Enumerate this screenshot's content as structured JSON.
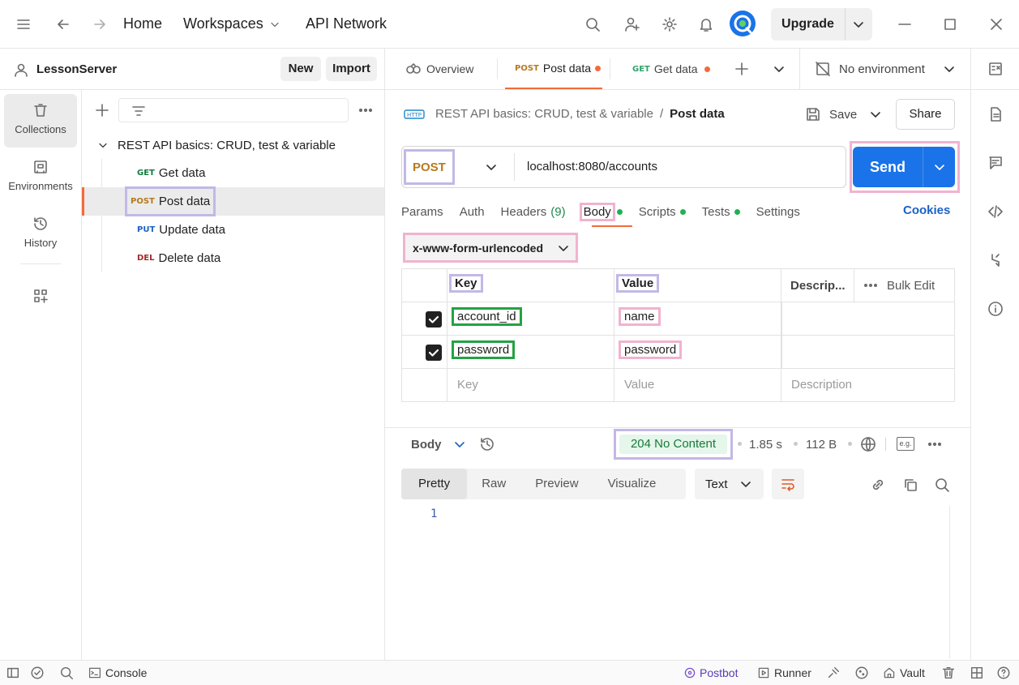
{
  "topbar": {
    "home": "Home",
    "workspaces": "Workspaces",
    "api_network": "API Network",
    "upgrade": "Upgrade",
    "avatar_color": "#1a73e8"
  },
  "sidebar": {
    "workspace_name": "LessonServer",
    "new_label": "New",
    "import_label": "Import",
    "rail": [
      {
        "label": "Collections",
        "icon": "trash-can-icon"
      },
      {
        "label": "Environments",
        "icon": "environment-icon"
      },
      {
        "label": "History",
        "icon": "history-icon"
      }
    ],
    "collection_name": "REST API basics: CRUD, test & variable",
    "requests": [
      {
        "method": "GET",
        "name": "Get data"
      },
      {
        "method": "POST",
        "name": "Post data"
      },
      {
        "method": "PUT",
        "name": "Update data"
      },
      {
        "method": "DEL",
        "name": "Delete data"
      }
    ]
  },
  "tabs": {
    "overview": "Overview",
    "tab1_method": "POST",
    "tab1_name": "Post data",
    "tab2_method": "GET",
    "tab2_name": "Get data",
    "environment": "No environment"
  },
  "request": {
    "breadcrumb_collection": "REST API basics: CRUD, test & variable",
    "breadcrumb_sep": "/",
    "breadcrumb_request": "Post data",
    "save": "Save",
    "share": "Share",
    "method": "POST",
    "url": "localhost:8080/accounts",
    "send": "Send",
    "subtabs": {
      "params": "Params",
      "auth": "Auth",
      "headers": "Headers",
      "headers_count": "(9)",
      "body": "Body",
      "scripts": "Scripts",
      "tests": "Tests",
      "settings": "Settings",
      "cookies": "Cookies"
    },
    "body_type": "x-www-form-urlencoded",
    "table": {
      "key_header": "Key",
      "value_header": "Value",
      "desc_header": "Descrip...",
      "bulk_edit": "Bulk Edit",
      "rows": [
        {
          "key": "account_id",
          "value": "name"
        },
        {
          "key": "password",
          "value": "password"
        }
      ],
      "key_placeholder": "Key",
      "value_placeholder": "Value",
      "desc_placeholder": "Description"
    }
  },
  "response": {
    "body_label": "Body",
    "status": "204 No Content",
    "time": "1.85 s",
    "size": "112 B",
    "eg": "e.g.",
    "views": [
      "Pretty",
      "Raw",
      "Preview",
      "Visualize"
    ],
    "format": "Text",
    "line_number": "1"
  },
  "statusbar": {
    "console": "Console",
    "postbot": "Postbot",
    "runner": "Runner",
    "vault": "Vault"
  }
}
